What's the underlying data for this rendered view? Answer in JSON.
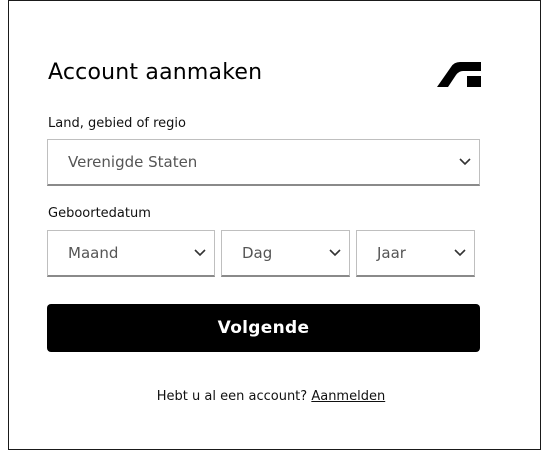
{
  "header": {
    "title": "Account aanmaken",
    "logo_icon": "autodesk-logo-icon"
  },
  "country": {
    "label": "Land, gebied of regio",
    "selected": "Verenigde Staten",
    "icon": "chevron-down-icon"
  },
  "birthdate": {
    "label": "Geboortedatum",
    "month": "Maand",
    "day": "Dag",
    "year": "Jaar"
  },
  "actions": {
    "next_label": "Volgende"
  },
  "footer": {
    "prompt": "Hebt u al een account?",
    "signin_link": "Aanmelden"
  },
  "colors": {
    "button_bg": "#000000",
    "button_text": "#ffffff",
    "field_border": "#bfbfbf",
    "field_underline": "#8a8a8a"
  }
}
